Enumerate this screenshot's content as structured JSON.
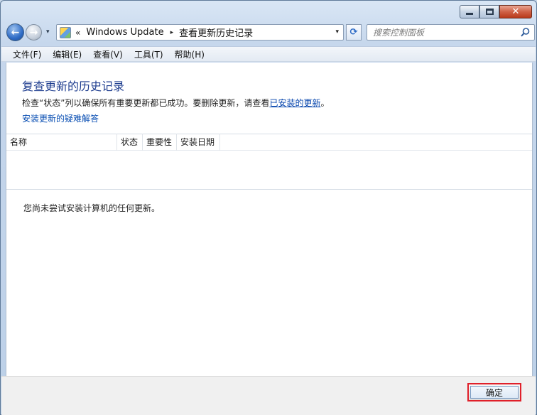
{
  "window": {
    "minimize_label": "—",
    "maximize_label": "□",
    "close_label": "✕"
  },
  "nav": {
    "back_icon": "←",
    "forward_icon": "→",
    "history_icon": "▾"
  },
  "address": {
    "chevron": "«",
    "segments": [
      "Windows Update",
      "查看更新历史记录"
    ],
    "separator": "▸",
    "dropdown": "▾"
  },
  "refresh_icon": "⟳",
  "search": {
    "placeholder": "搜索控制面板"
  },
  "menu": {
    "items": [
      "文件(F)",
      "编辑(E)",
      "查看(V)",
      "工具(T)",
      "帮助(H)"
    ]
  },
  "main": {
    "title": "复查更新的历史记录",
    "description_prefix": "检查“状态”列以确保所有重要更新都已成功。要删除更新，请查看",
    "description_link": "已安装的更新",
    "description_suffix": "。",
    "troubleshoot_link": "安装更新的疑难解答",
    "columns": [
      "名称",
      "状态",
      "重要性",
      "安装日期"
    ],
    "empty_message": "您尚未尝试安装计算机的任何更新。"
  },
  "footer": {
    "ok_label": "确定"
  },
  "colors": {
    "title": "#1e3d8f",
    "link": "#0645ad",
    "highlight_border": "#e0202a"
  }
}
